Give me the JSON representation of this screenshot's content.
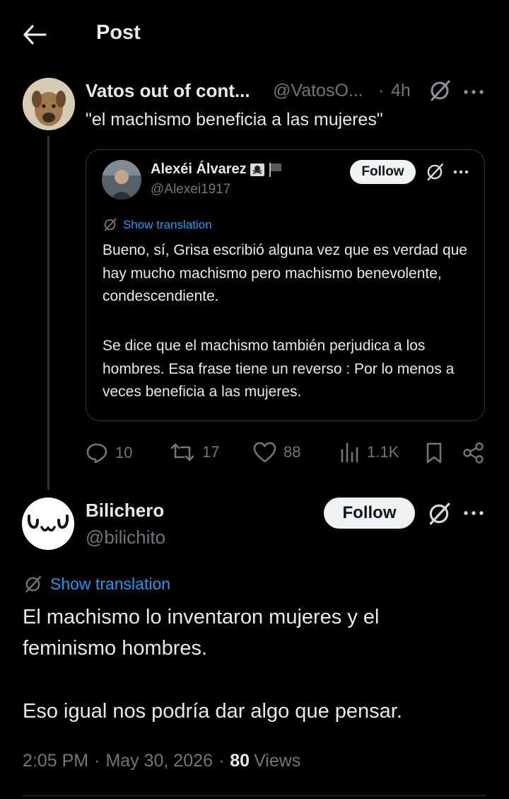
{
  "header": {
    "title": "Post",
    "back_icon": "arrow-left-icon"
  },
  "parent_tweet": {
    "author_name": "Vatos out of cont...",
    "handle": "@VatosO...",
    "separator": "·",
    "time": "4h",
    "text": "\"el machismo beneficia a las mujeres\"",
    "quoted": {
      "author_name": "Alexéi Álvarez",
      "handle": "@Alexei1917",
      "follow_label": "Follow",
      "translate_label": "Show translation",
      "paragraph1": "Bueno, sí, Grisa escribió alguna vez que es verdad que hay mucho machismo pero machismo benevolente, condescendiente.",
      "paragraph2": "Se dice que el machismo también perjudica a los hombres. Esa frase tiene un reverso : Por lo menos a veces beneficia a las mujeres."
    },
    "stats": {
      "replies": "10",
      "reposts": "17",
      "likes": "88",
      "views": "1.1K"
    }
  },
  "main_tweet": {
    "author_name": "Bilichero",
    "handle": "@bilichito",
    "follow_label": "Follow",
    "translate_label": "Show translation",
    "paragraph1": "El machismo lo inventaron mujeres y el feminismo hombres.",
    "paragraph2": "Eso igual nos podría dar algo que pensar.",
    "time": "2:05 PM",
    "date": "May 30, 2026",
    "dot": "·",
    "views_count": "80",
    "views_label": "Views"
  },
  "colors": {
    "background": "#000000",
    "text": "#e7e9ea",
    "muted": "#71767b",
    "link": "#1d9bf0",
    "button_bg": "#eff3f4"
  }
}
